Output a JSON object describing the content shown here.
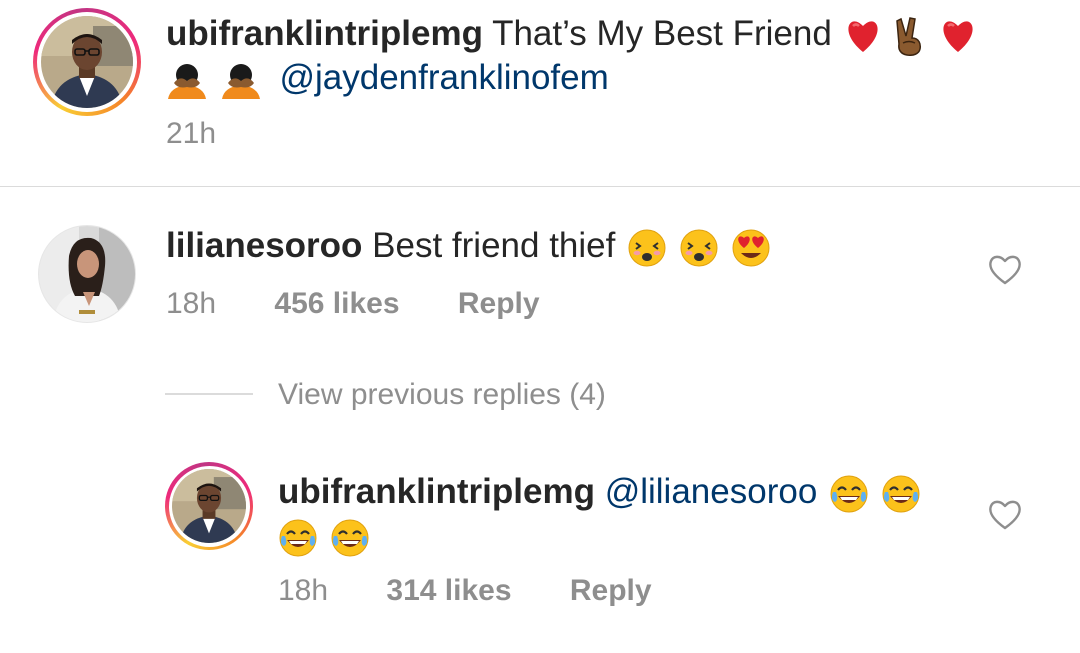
{
  "caption": {
    "username": "ubifranklintriplemg",
    "text": "That’s My Best Friend",
    "line1_emojis": [
      "heart-emoji",
      "victory-hand-emoji",
      "heart-emoji"
    ],
    "line2_emojis": [
      "person-facepalming-emoji",
      "person-facepalming-emoji"
    ],
    "mention": "@jaydenfranklinofem",
    "time": "21h"
  },
  "comment": {
    "username": "lilianesoroo",
    "text": "Best friend thief",
    "emojis": [
      "face-with-closed-eyes-kiss-emoji",
      "face-with-closed-eyes-kiss-emoji",
      "heart-eyes-emoji"
    ],
    "time": "18h",
    "likes": "456 likes",
    "reply_label": "Reply"
  },
  "view_replies": {
    "label": "View previous replies (4)"
  },
  "reply": {
    "username": "ubifranklintriplemg",
    "mention": "@lilianesoroo",
    "emojis_line1": [
      "tears-of-joy-emoji",
      "tears-of-joy-emoji"
    ],
    "emojis_line2": [
      "tears-of-joy-emoji",
      "tears-of-joy-emoji"
    ],
    "time": "18h",
    "likes": "314 likes",
    "reply_label": "Reply"
  },
  "colors": {
    "text": "#262626",
    "meta": "#8e8e8e",
    "mention": "#00376b",
    "divider": "#dbdbdb"
  }
}
